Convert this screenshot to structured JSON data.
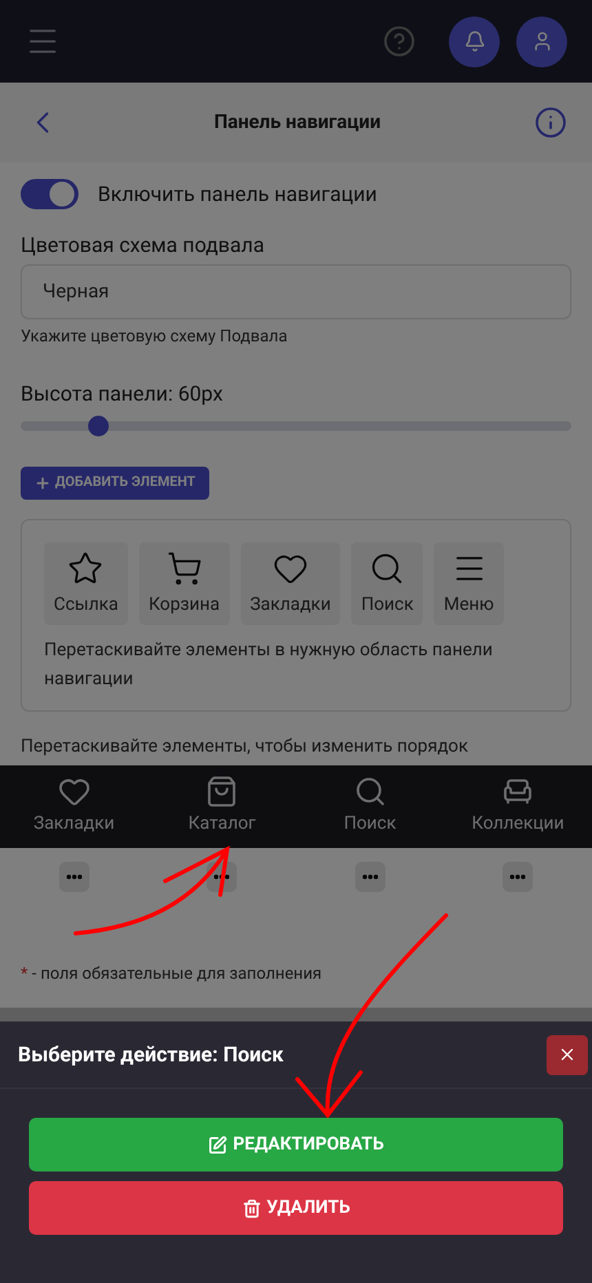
{
  "header": {
    "title": "Панель навигации"
  },
  "toggle": {
    "label": "Включить панель навигации",
    "on": true
  },
  "color_scheme": {
    "label": "Цветовая схема подвала",
    "value": "Черная",
    "hint": "Укажите цветовую схему Подвала"
  },
  "height": {
    "label": "Высота панели: 60px",
    "level": 0.14
  },
  "add_button": "ДОБАВИТЬ ЭЛЕМЕНТ",
  "palette": {
    "items": [
      {
        "label": "Ссылка"
      },
      {
        "label": "Корзина"
      },
      {
        "label": "Закладки"
      },
      {
        "label": "Поиск"
      },
      {
        "label": "Меню"
      }
    ],
    "hint": "Перетаскивайте элементы в нужную область панели навигации"
  },
  "reorder_hint": "Перетаскивайте элементы, чтобы изменить порядок",
  "nav_preview": [
    {
      "label": "Закладки"
    },
    {
      "label": "Каталог"
    },
    {
      "label": "Поиск"
    },
    {
      "label": "Коллекции"
    }
  ],
  "required_note": {
    "mark": "*",
    "text": "- поля обязательные для заполнения"
  },
  "sheet": {
    "title": "Выберите действие: Поиск",
    "buttons": [
      {
        "label": "РЕДАКТИРОВАТЬ",
        "kind": "edit"
      },
      {
        "label": "УДАЛИТЬ",
        "kind": "delete"
      }
    ]
  }
}
